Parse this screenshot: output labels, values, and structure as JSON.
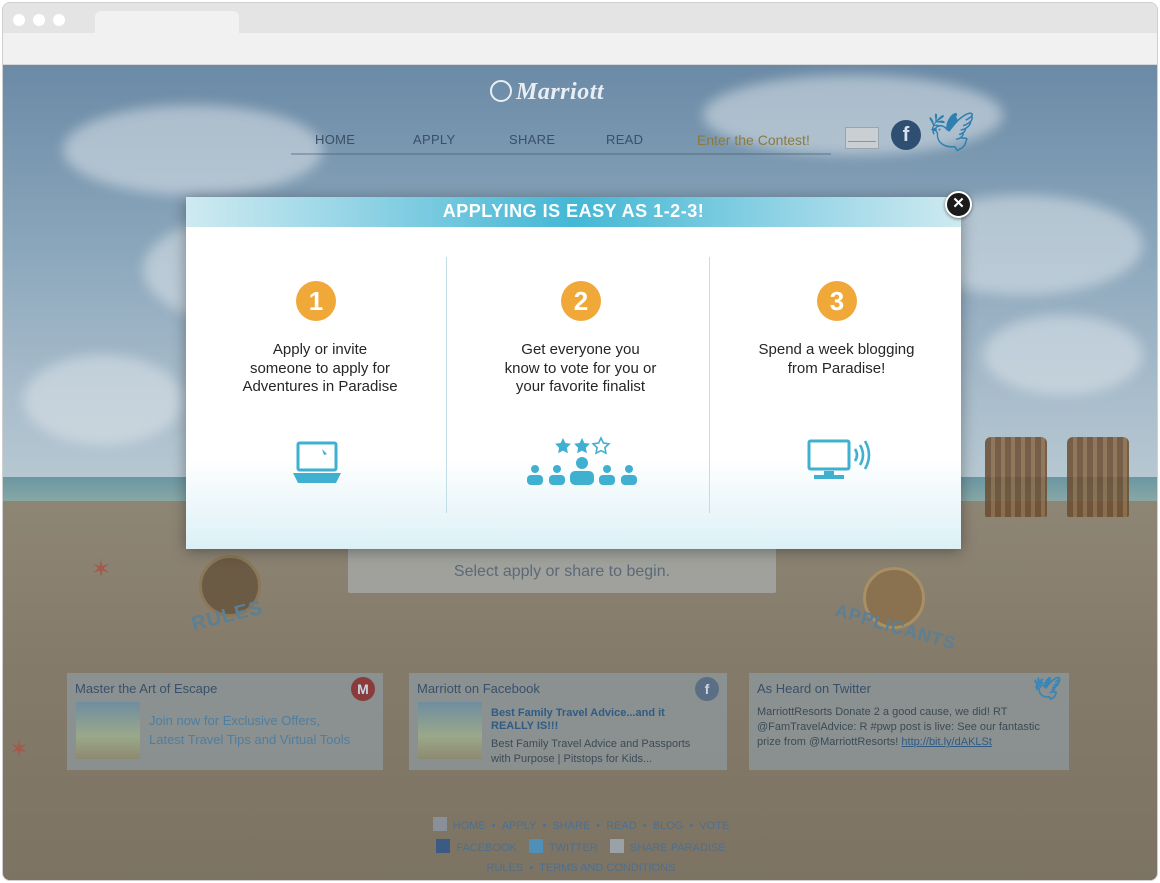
{
  "site": {
    "logo_text": "Marriott",
    "nav": [
      "HOME",
      "APPLY",
      "SHARE",
      "READ"
    ],
    "contest_label": "Enter the Contest!"
  },
  "background": {
    "panel_text": "Select apply or share to begin.",
    "rules_label": "RULES",
    "applicants_label": "APPLICANTS"
  },
  "cards": {
    "escape": {
      "title": "Master the Art of Escape",
      "line1": "Join now for Exclusive Offers,",
      "line2": "Latest Travel Tips and Virtual Tools"
    },
    "facebook": {
      "title": "Marriott on Facebook",
      "link_line1": "Best Family Travel Advice...and it",
      "link_line2": "REALLY IS!!!",
      "body_line1": "Best Family Travel Advice and Passports",
      "body_line2": "with Purpose | Pitstops for Kids..."
    },
    "twitter": {
      "title": "As Heard on Twitter",
      "line1": "MarriottResorts Donate 2 a good cause, we did! RT",
      "line2": "@FamTravelAdvice: R #pwp post is live: See our fantastic",
      "line3": "prize from @MarriottResorts!",
      "link": "http://bit.ly/dAKLSt"
    }
  },
  "footer": {
    "row1": [
      "HOME",
      "APPLY",
      "SHARE",
      "READ",
      "BLOG",
      "VOTE"
    ],
    "facebook": "FACEBOOK",
    "twitter": "TWITTER",
    "share": "SHARE PARADISE",
    "rules": "RULES",
    "terms": "TERMS AND CONDITIONS"
  },
  "modal": {
    "title": "APPLYING IS EASY AS 1-2-3!",
    "close_label": "✕",
    "steps": [
      {
        "number": "1",
        "line1": "Apply or invite",
        "line2": "someone to apply for",
        "line3": "Adventures in Paradise",
        "icon": "laptop-icon"
      },
      {
        "number": "2",
        "line1": "Get everyone you",
        "line2": "know to vote for you or",
        "line3": "your favorite finalist",
        "icon": "voting-crowd-icon"
      },
      {
        "number": "3",
        "line1": "Spend a week blogging",
        "line2": "from Paradise!",
        "icon": "broadcast-monitor-icon"
      }
    ]
  },
  "colors": {
    "accent_orange": "#f0a839",
    "header_cyan": "#44b8d6",
    "icon_teal": "#3fb0cf"
  }
}
